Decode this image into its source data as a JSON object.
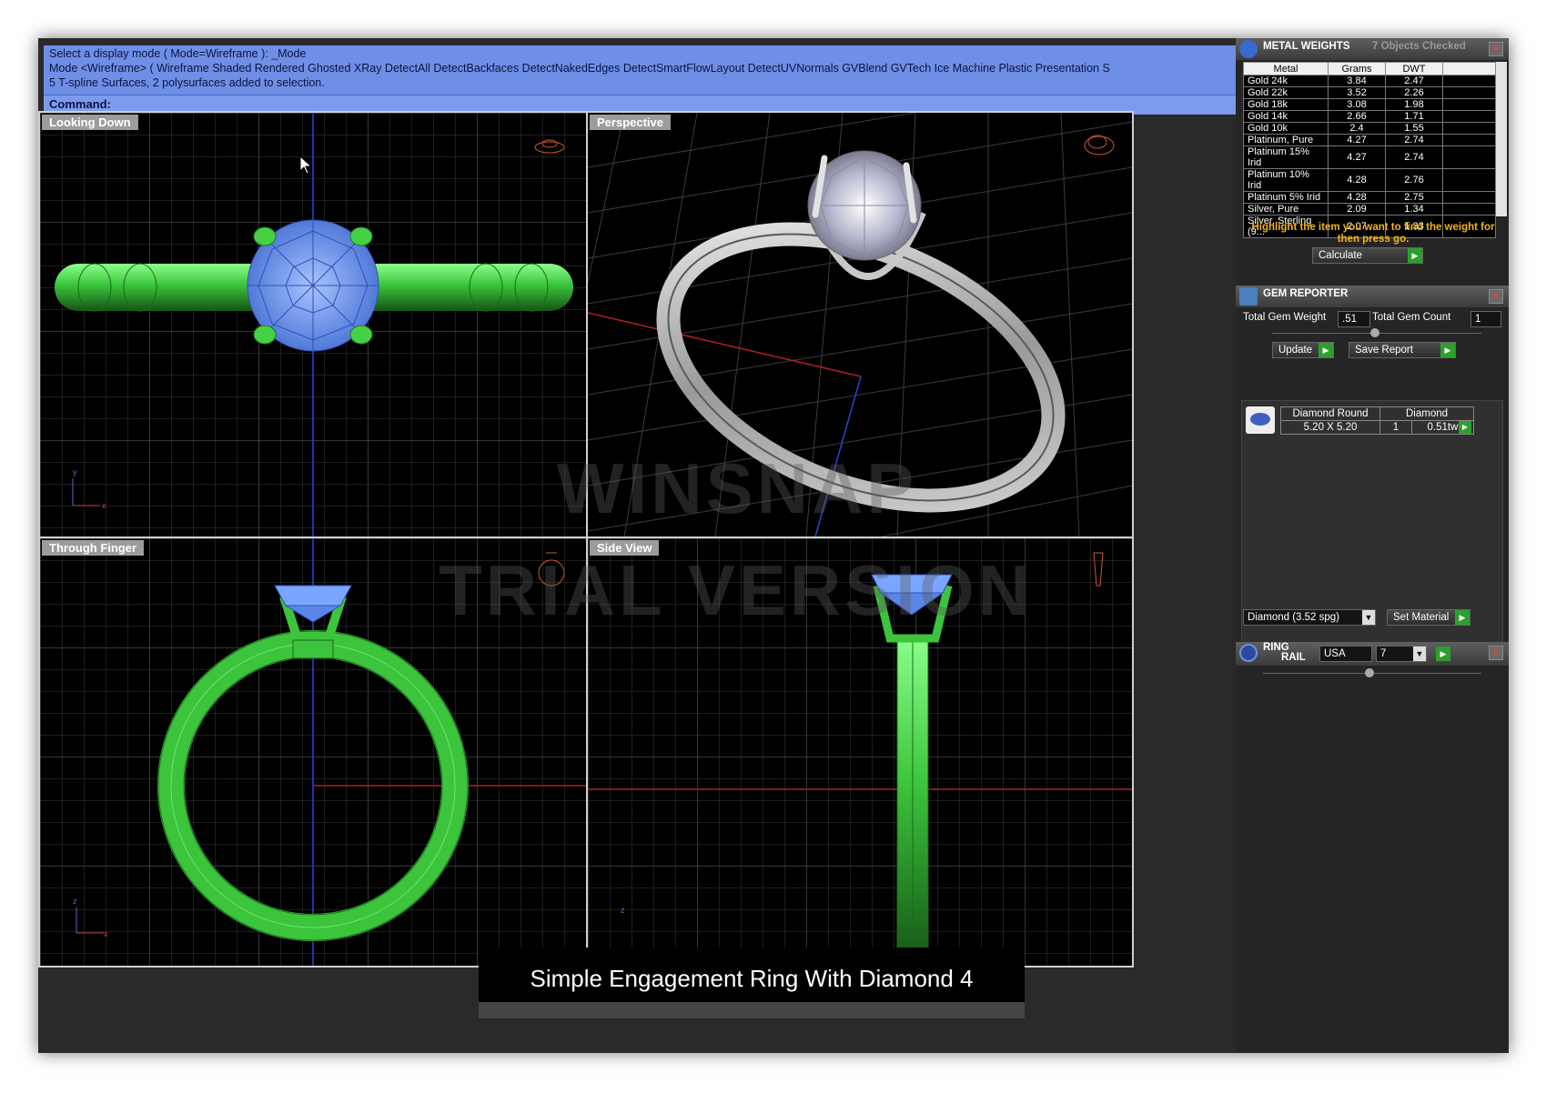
{
  "command": {
    "lines": [
      "Select a display mode ( Mode=Wireframe ): _Mode",
      "Mode <Wireframe> ( Wireframe  Shaded  Rendered  Ghosted  XRay  DetectAll  DetectBackfaces  DetectNakedEdges  DetectSmartFlowLayout  DetectUVNormals  GVBlend  GVTech  Ice  Machine  Plastic  Presentation  S",
      "5 T-spline Surfaces, 2 polysurfaces added to selection."
    ],
    "prompt": "Command:"
  },
  "viewports": {
    "top_left": "Looking Down",
    "top_right": "Perspective",
    "bottom_left": "Through Finger",
    "bottom_right": "Side View"
  },
  "metal_weights": {
    "title": "METAL WEIGHTS",
    "status": "7 Objects Checked",
    "columns": [
      "Metal",
      "Grams",
      "DWT"
    ],
    "rows": [
      [
        "Gold 24k",
        "3.84",
        "2.47"
      ],
      [
        "Gold 22k",
        "3.52",
        "2.26"
      ],
      [
        "Gold 18k",
        "3.08",
        "1.98"
      ],
      [
        "Gold 14k",
        "2.66",
        "1.71"
      ],
      [
        "Gold 10k",
        "2.4",
        "1.55"
      ],
      [
        "Platinum, Pure",
        "4.27",
        "2.74"
      ],
      [
        "Platinum 15% Irid",
        "4.27",
        "2.74"
      ],
      [
        "Platinum 10% Irid",
        "4.28",
        "2.76"
      ],
      [
        "Platinum 5% Irid",
        "4.28",
        "2.75"
      ],
      [
        "Silver, Pure",
        "2.09",
        "1.34"
      ],
      [
        "Silver, Sterling (9...",
        "2.07",
        "1.33"
      ]
    ],
    "note": "Highlight the item you want to find the weight for then press go.",
    "calculate": "Calculate"
  },
  "gem_reporter": {
    "title": "GEM REPORTER",
    "total_weight_label": "Total Gem Weight",
    "total_weight": ".51",
    "total_count_label": "Total Gem Count",
    "total_count": "1",
    "update": "Update",
    "save_report": "Save Report",
    "gem": {
      "shape": "Diamond Round",
      "material": "Diamond",
      "size": "5.20 X 5.20",
      "qty": "1",
      "weight": "0.51tw"
    },
    "material_select": "Diamond    (3.52 spg)",
    "set_material": "Set Material"
  },
  "ring_rail": {
    "title_line1": "RING",
    "title_line2": "RAIL",
    "country": "USA",
    "size": "7"
  },
  "watermark": {
    "line1": "WINSNAP",
    "line2": "TRIAL VERSION"
  },
  "caption": "Simple Engagement Ring With Diamond 4",
  "colors": {
    "command_bg": "#6f8fe6",
    "ring_green": "#3fc83f",
    "gem_blue": "#7aa6ff",
    "note_orange": "#f3b21a"
  }
}
